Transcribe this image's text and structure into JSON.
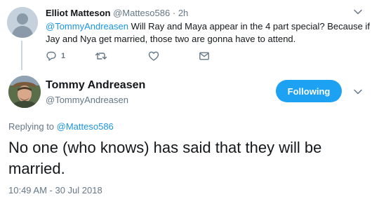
{
  "parent_tweet": {
    "author_name": "Elliot Matteson",
    "author_handle": "@Matteso586",
    "separator": "·",
    "time_ago": "2h",
    "mention": "@TommyAndreasen",
    "text": " Will Ray and Maya appear in the 4 part special? Because if Jay and Nya get married, those two are gonna have to attend.",
    "actions": {
      "reply_count": "1",
      "retweet_count": "",
      "like_count": ""
    }
  },
  "main_tweet": {
    "author_name": "Tommy Andreasen",
    "author_handle": "@TommyAndreasen",
    "follow_button_label": "Following",
    "replying_prefix": "Replying to ",
    "replying_to": "@Matteso586",
    "text": "No one (who knows) has said that they will be married.",
    "timestamp": "10:49 AM - 30 Jul 2018"
  },
  "colors": {
    "accent": "#1da1f2",
    "link": "#1b95e0",
    "secondary_text": "#657786",
    "primary_text": "#14171a"
  },
  "icons": [
    "chevron-down-icon",
    "reply-icon",
    "retweet-icon",
    "like-icon",
    "direct-message-icon"
  ]
}
